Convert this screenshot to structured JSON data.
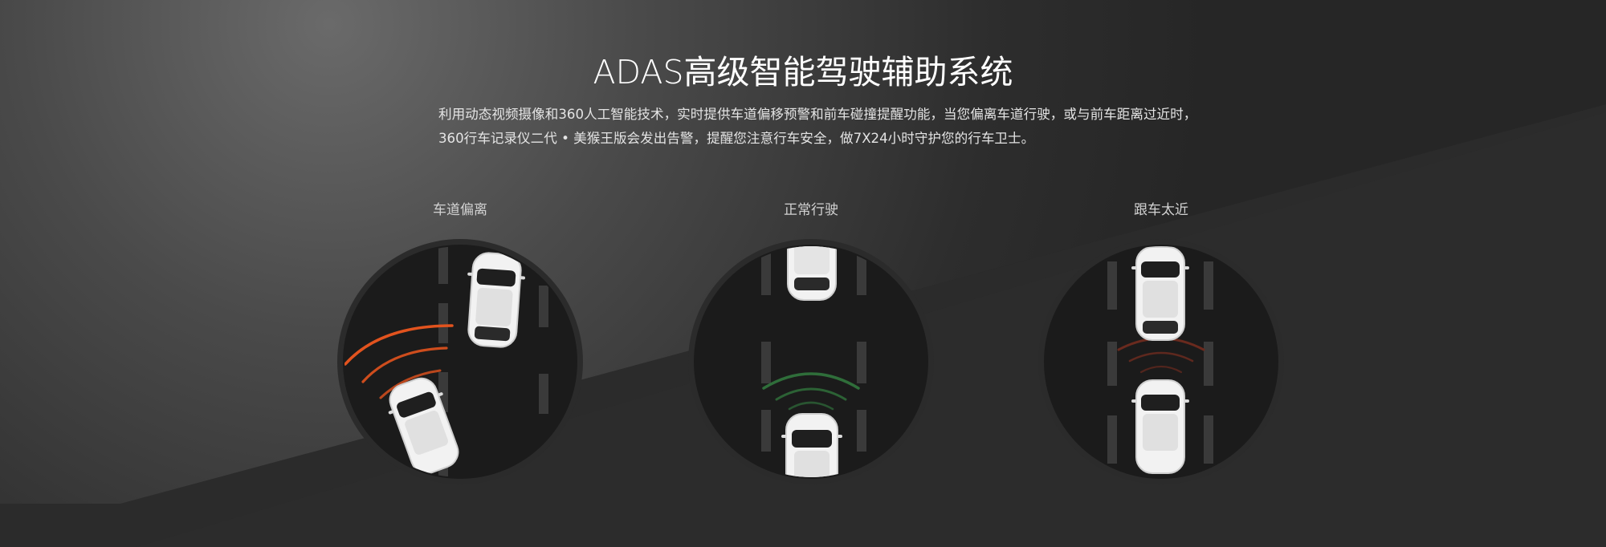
{
  "section": {
    "title": "ADAS高级智能驾驶辅助系统",
    "description_lines": [
      "利用动态视频摄像和360人工智能技术，实时提供车道偏移预警和前车碰撞提醒功能，当您偏离车道行驶，或与前车距离过近时，",
      "360行车记录仪二代 • 美猴王版会发出告警，提醒您注意行车安全，做7X24小时守护您的行车卫士。"
    ]
  },
  "panels": [
    {
      "label": "车道偏离",
      "alert_color": "#e2531e",
      "icon": "lane-departure-scene"
    },
    {
      "label": "正常行驶",
      "alert_color": "#2f6e3a",
      "icon": "normal-driving-scene"
    },
    {
      "label": "跟车太近",
      "alert_color": "#6a2a1e",
      "icon": "following-too-close-scene"
    }
  ],
  "colors": {
    "background_dark": "#262626",
    "background_highlight": "#6b6b6b",
    "dial_ring": "#2b2b2b",
    "dial_face": "#1b1b1b"
  }
}
